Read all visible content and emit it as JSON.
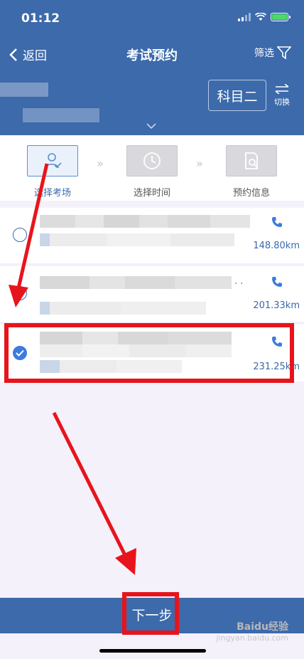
{
  "status": {
    "time": "01:12"
  },
  "nav": {
    "back_label": "返回",
    "title": "考试预约",
    "filter_label": "筛选"
  },
  "header": {
    "subject": "科目二",
    "switch_label": "切换"
  },
  "steps": [
    {
      "label": "选择考场",
      "state": "active"
    },
    {
      "label": "选择时间",
      "state": "inactive"
    },
    {
      "label": "预约信息",
      "state": "inactive"
    }
  ],
  "venues": [
    {
      "distance": "148.80km",
      "selected": false
    },
    {
      "distance": "201.33km",
      "selected": false
    },
    {
      "distance": "231.25km",
      "selected": true
    }
  ],
  "footer": {
    "next_label": "下一步"
  },
  "watermark": {
    "brand": "Baidu经验",
    "url": "jingyan.baidu.com"
  },
  "colors": {
    "primary": "#3c6aab",
    "highlight": "#e8141b",
    "check": "#3c7be0"
  }
}
